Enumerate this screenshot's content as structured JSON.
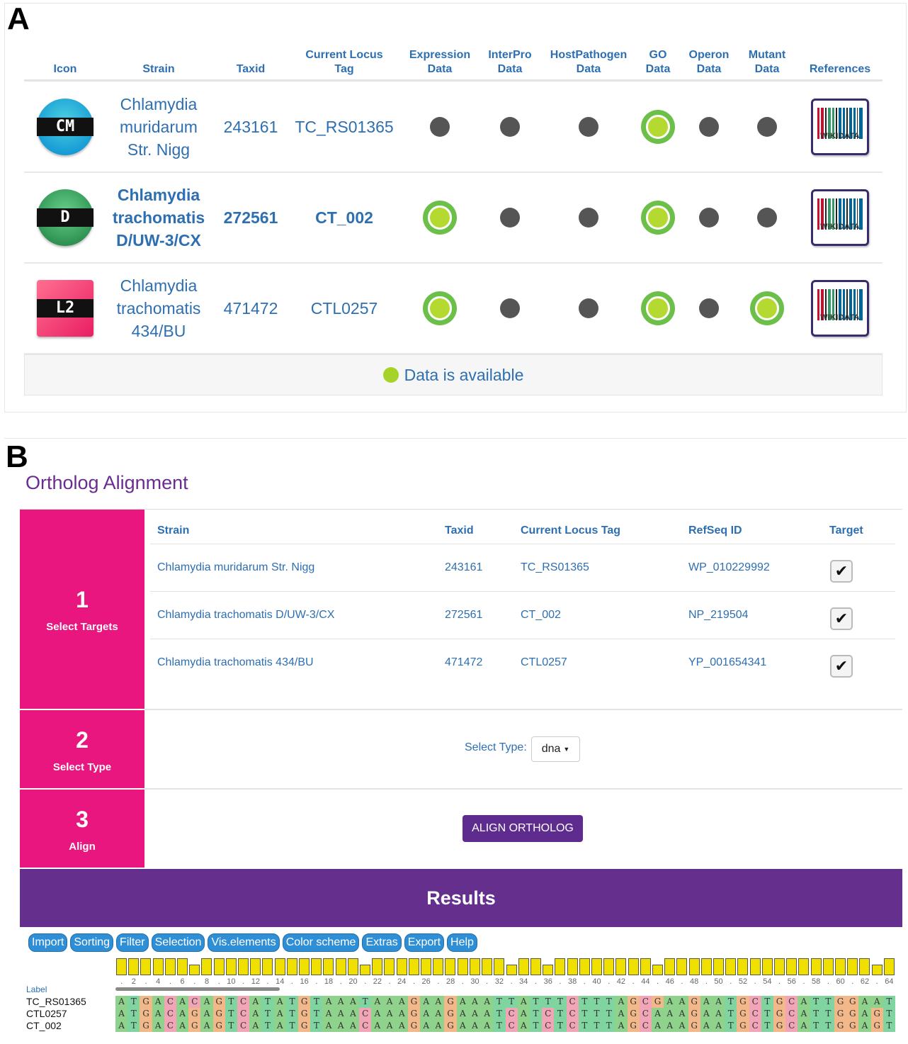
{
  "panelA": {
    "letter": "A",
    "headers": [
      {
        "key": "icon",
        "label": "Icon"
      },
      {
        "key": "strain",
        "label": "Strain"
      },
      {
        "key": "taxid",
        "label": "Taxid"
      },
      {
        "key": "locus",
        "label": "Current Locus\nTag"
      },
      {
        "key": "expression",
        "label": "Expression\nData"
      },
      {
        "key": "interpro",
        "label": "InterPro\nData"
      },
      {
        "key": "hostpathogen",
        "label": "HostPathogen\nData"
      },
      {
        "key": "go",
        "label": "GO\nData"
      },
      {
        "key": "operon",
        "label": "Operon\nData"
      },
      {
        "key": "mutant",
        "label": "Mutant\nData"
      },
      {
        "key": "references",
        "label": "References"
      }
    ],
    "rows": [
      {
        "icon_text": "CM",
        "strain": "Chlamydia\nmuridarum\nStr. Nigg",
        "taxid": "243161",
        "locus": "TC_RS01365",
        "bold": false,
        "expression": false,
        "interpro": false,
        "hostpathogen": false,
        "go": true,
        "operon": false,
        "mutant": false,
        "reference": "WIKIDATA"
      },
      {
        "icon_text": "D",
        "strain": "Chlamydia\ntrachomatis\nD/UW-3/CX",
        "taxid": "272561",
        "locus": "CT_002",
        "bold": true,
        "expression": true,
        "interpro": false,
        "hostpathogen": false,
        "go": true,
        "operon": false,
        "mutant": false,
        "reference": "WIKIDATA"
      },
      {
        "icon_text": "L2",
        "strain": "Chlamydia\ntrachomatis\n434/BU",
        "taxid": "471472",
        "locus": "CTL0257",
        "bold": false,
        "expression": true,
        "interpro": false,
        "hostpathogen": false,
        "go": true,
        "operon": false,
        "mutant": true,
        "reference": "WIKIDATA"
      }
    ],
    "legend": "Data is available",
    "colors": {
      "available": "#6cc04a",
      "unavailable": "#555555",
      "link": "#2d6fb1"
    }
  },
  "panelB": {
    "letter": "B",
    "title": "Ortholog Alignment",
    "steps": [
      {
        "num": "1",
        "label": "Select Targets"
      },
      {
        "num": "2",
        "label": "Select Type"
      },
      {
        "num": "3",
        "label": "Align"
      }
    ],
    "table_headers": [
      "Strain",
      "Taxid",
      "Current Locus Tag",
      "RefSeq ID",
      "Target"
    ],
    "table_rows": [
      {
        "strain": "Chlamydia muridarum Str. Nigg",
        "taxid": "243161",
        "locus": "TC_RS01365",
        "refseq": "WP_010229992",
        "target": true
      },
      {
        "strain": "Chlamydia trachomatis D/UW-3/CX",
        "taxid": "272561",
        "locus": "CT_002",
        "refseq": "NP_219504",
        "target": true
      },
      {
        "strain": "Chlamydia trachomatis 434/BU",
        "taxid": "471472",
        "locus": "CTL0257",
        "refseq": "YP_001654341",
        "target": true
      }
    ],
    "select_type_label": "Select Type:",
    "select_type_value": "dna",
    "align_button": "ALIGN ORTHOLOG",
    "results_title": "Results",
    "menu": [
      "Import",
      "Sorting",
      "Filter",
      "Selection",
      "Vis.elements",
      "Color scheme",
      "Extras",
      "Export",
      "Help"
    ],
    "ruler_labels": [
      "2",
      "4",
      "6",
      "8",
      "10",
      "12",
      "14",
      "16",
      "18",
      "20",
      "22",
      "24",
      "26",
      "28",
      "30",
      "32",
      "34",
      "36",
      "38",
      "40",
      "42",
      "44",
      "46",
      "48",
      "50",
      "52",
      "54",
      "56",
      "58",
      "60",
      "62",
      "64"
    ],
    "label_header": "Label",
    "sequences": [
      {
        "label": "TC_RS01365",
        "seq": "ATGACACAGTCATATGTAAATAAAGAAGAAATTATTTCTTTAGCGAAGAATGCTGCATTGGAAT"
      },
      {
        "label": "CTL0257",
        "seq": "ATGACAGAGTCATATGTAAACAAAGAAGAAATCATCTCTTTAGCAAAGAATGCTGCATTGGAGT"
      },
      {
        "label": "CT_002",
        "seq": "ATGACAGAGTCATATGTAAACAAAGAAGAAATCATCTCTTTAGCAAAGAATGCTGCATTGGAGT"
      }
    ],
    "colors": {
      "step": "#e8167e",
      "results": "#652f8e",
      "title": "#6a2c91",
      "A": "#8fd28b",
      "T": "#7fd4a0",
      "G": "#f2b889",
      "C": "#f2a5b6",
      "conservation": "#f0e000"
    }
  }
}
